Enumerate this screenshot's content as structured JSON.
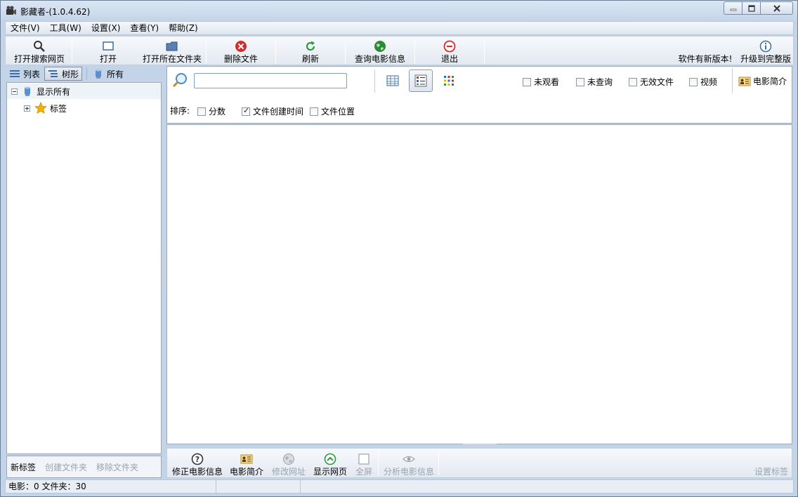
{
  "window": {
    "title": "影藏者-(1.0.4.62)"
  },
  "menu": [
    "文件(V)",
    "工具(W)",
    "设置(X)",
    "查看(Y)",
    "帮助(Z)"
  ],
  "toolbar": {
    "open_search": "打开搜索网页",
    "open": "打开",
    "open_folder": "打开所在文件夹",
    "delete_file": "删除文件",
    "refresh": "刷新",
    "query_info": "查询电影信息",
    "exit": "退出",
    "new_version": "软件有新版本!",
    "upgrade": "升级到完整版"
  },
  "left": {
    "tabs": {
      "list": "列表",
      "tree": "树形",
      "all": "所有"
    },
    "tree": {
      "show_all": "显示所有",
      "tags": "标签"
    },
    "bottom": {
      "new_tag": "新标签",
      "create_folder": "创建文件夹",
      "remove_folder": "移除文件夹"
    }
  },
  "search": {
    "value": "",
    "filters": {
      "unwatched": "未观看",
      "unqueried": "未查询",
      "invalid": "无效文件",
      "video": "视频"
    },
    "intro": "电影简介",
    "sort_label": "排序:",
    "sort": {
      "score": "分数",
      "created": "文件创建时间",
      "location": "文件位置"
    },
    "checked": {
      "unwatched": false,
      "unqueried": false,
      "invalid": false,
      "video": false,
      "score": false,
      "created": true,
      "location": false
    }
  },
  "bottom": {
    "fix_info": "修正电影信息",
    "intro": "电影简介",
    "edit_url": "修改网址",
    "show_page": "显示网页",
    "fullscreen": "全屏",
    "analyze": "分析电影信息",
    "set_tag": "设置标签"
  },
  "status": {
    "summary": "电影：0 文件夹：30"
  },
  "colors": {
    "accent": "#3a6ea5",
    "delete": "#d42b2b",
    "refresh": "#2a9a3c",
    "exit": "#d42b2b",
    "star": "#f0b400"
  }
}
